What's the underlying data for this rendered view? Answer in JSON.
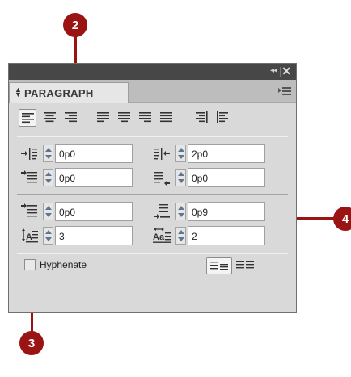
{
  "panel": {
    "title": "PARAGRAPH",
    "collapse_glyph": "◂◂",
    "close_glyph": "✕",
    "tab_arrows": "⬍"
  },
  "alignment_buttons": [
    {
      "name": "align-left",
      "active": true
    },
    {
      "name": "align-center",
      "active": false
    },
    {
      "name": "align-right",
      "active": false
    },
    {
      "name": "justify-left",
      "active": false
    },
    {
      "name": "justify-center",
      "active": false
    },
    {
      "name": "justify-right",
      "active": false
    },
    {
      "name": "justify-all",
      "active": false
    },
    {
      "name": "align-towards-spine",
      "active": false
    },
    {
      "name": "align-away-from-spine",
      "active": false
    }
  ],
  "fields": {
    "left_indent": "0p0",
    "right_indent": "2p0",
    "first_line_left_indent": "0p0",
    "last_line_right_indent": "0p0",
    "space_before": "0p0",
    "space_after": "0p9",
    "drop_cap_lines": "3",
    "drop_cap_characters": "2"
  },
  "hyphenate": {
    "label": "Hyphenate",
    "checked": false
  },
  "composer_buttons": [
    {
      "name": "paragraph-composer",
      "active": true
    },
    {
      "name": "single-line-composer",
      "active": false
    }
  ],
  "callouts": {
    "c2": "2",
    "c3": "3",
    "c4": "4"
  },
  "colors": {
    "callout": "#9a1414",
    "panel_bg": "#d9d9d9",
    "titlebar": "#474747",
    "spinner_arrow": "#5f7590"
  }
}
